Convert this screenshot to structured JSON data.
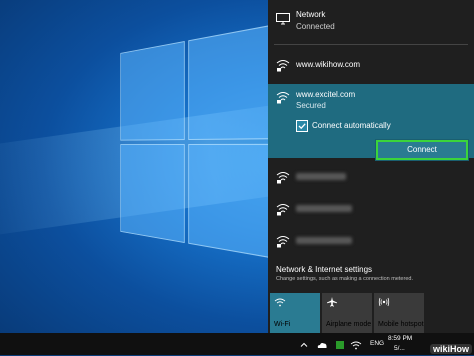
{
  "network_header": {
    "title": "Network",
    "status": "Connected"
  },
  "networks": [
    {
      "name": "www.wikihow.com",
      "icon": "wifi-secured-icon"
    },
    {
      "name": "www.excitel.com",
      "status": "Secured",
      "icon": "wifi-secured-icon",
      "selected": true
    }
  ],
  "selected_network": {
    "auto_connect_label": "Connect automatically",
    "auto_connect_checked": true,
    "connect_label": "Connect"
  },
  "hidden_networks_count": 3,
  "settings": {
    "title": "Network & Internet settings",
    "subtitle": "Change settings, such as making a connection metered."
  },
  "quick_actions": [
    {
      "label": "Wi-Fi",
      "icon": "wifi-icon",
      "active": true
    },
    {
      "label": "Airplane mode",
      "icon": "airplane-icon",
      "active": false
    },
    {
      "label": "Mobile hotspot",
      "icon": "hotspot-icon",
      "active": false
    }
  ],
  "taskbar": {
    "language": "ENG",
    "time": "8:59 PM",
    "date": "5/..."
  },
  "watermark": "wikiHow",
  "colors": {
    "accent": "#1f6b80",
    "highlight_border": "#3bd43b",
    "panel_bg": "#1f1f1f"
  }
}
